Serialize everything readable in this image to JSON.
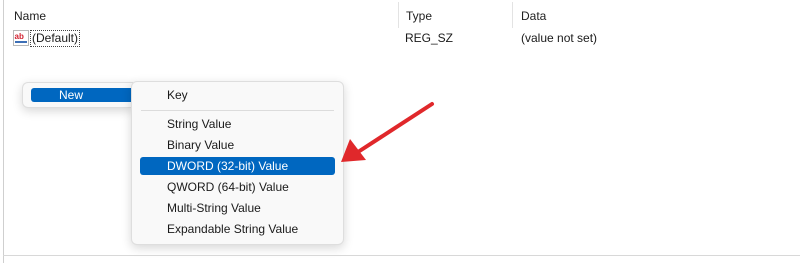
{
  "columns": {
    "name": "Name",
    "type": "Type",
    "data": "Data"
  },
  "rows": [
    {
      "icon": "ab-string-icon",
      "name": "(Default)",
      "type": "REG_SZ",
      "data": "(value not set)"
    }
  ],
  "context_menu": {
    "parent_item": {
      "label": "New",
      "arrow": "›"
    },
    "submenu": {
      "items": [
        {
          "label": "Key"
        },
        {
          "label": "String Value"
        },
        {
          "label": "Binary Value"
        },
        {
          "label": "DWORD (32-bit) Value",
          "selected": true
        },
        {
          "label": "QWORD (64-bit) Value"
        },
        {
          "label": "Multi-String Value"
        },
        {
          "label": "Expandable String Value"
        }
      ]
    }
  },
  "annotation": {
    "type": "red-arrow",
    "color": "#e0282b",
    "points_to": "DWORD (32-bit) Value"
  },
  "colors": {
    "selection": "#0067c0",
    "menu_background": "#f9f9f9"
  }
}
